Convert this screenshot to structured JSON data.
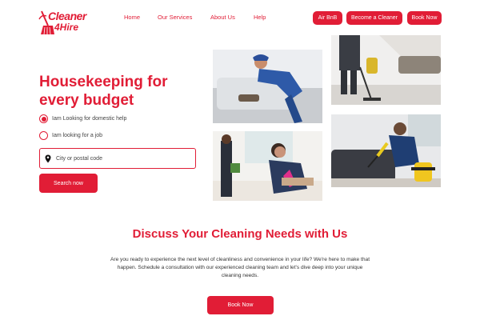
{
  "brand": {
    "line1": "Cleaner",
    "line2": "4Hire",
    "accent": "#e11d36"
  },
  "nav": {
    "items": [
      {
        "label": "Home"
      },
      {
        "label": "Our Services"
      },
      {
        "label": "About Us"
      },
      {
        "label": "Help"
      }
    ]
  },
  "header_buttons": {
    "airbnb": "Air BnB",
    "become_cleaner": "Become a Cleaner",
    "book_now": "Book Now"
  },
  "hero": {
    "title": "Housekeeping for every budget",
    "options": [
      {
        "label": "Iam Looking for domestic help",
        "selected": true
      },
      {
        "label": "Iam looking for a job",
        "selected": false
      }
    ],
    "search_placeholder": "City or postal code",
    "search_button": "Search now"
  },
  "icons": [
    "broom-logo-icon",
    "map-pin-icon"
  ],
  "discuss": {
    "title": "Discuss Your Cleaning Needs with Us",
    "text": "Are you ready to experience the next level of cleanliness and convenience in your life? We're here to make that happen. Schedule a consultation with our experienced cleaning team and let's dive deep into your unique cleaning needs.",
    "button": "Book Now"
  }
}
